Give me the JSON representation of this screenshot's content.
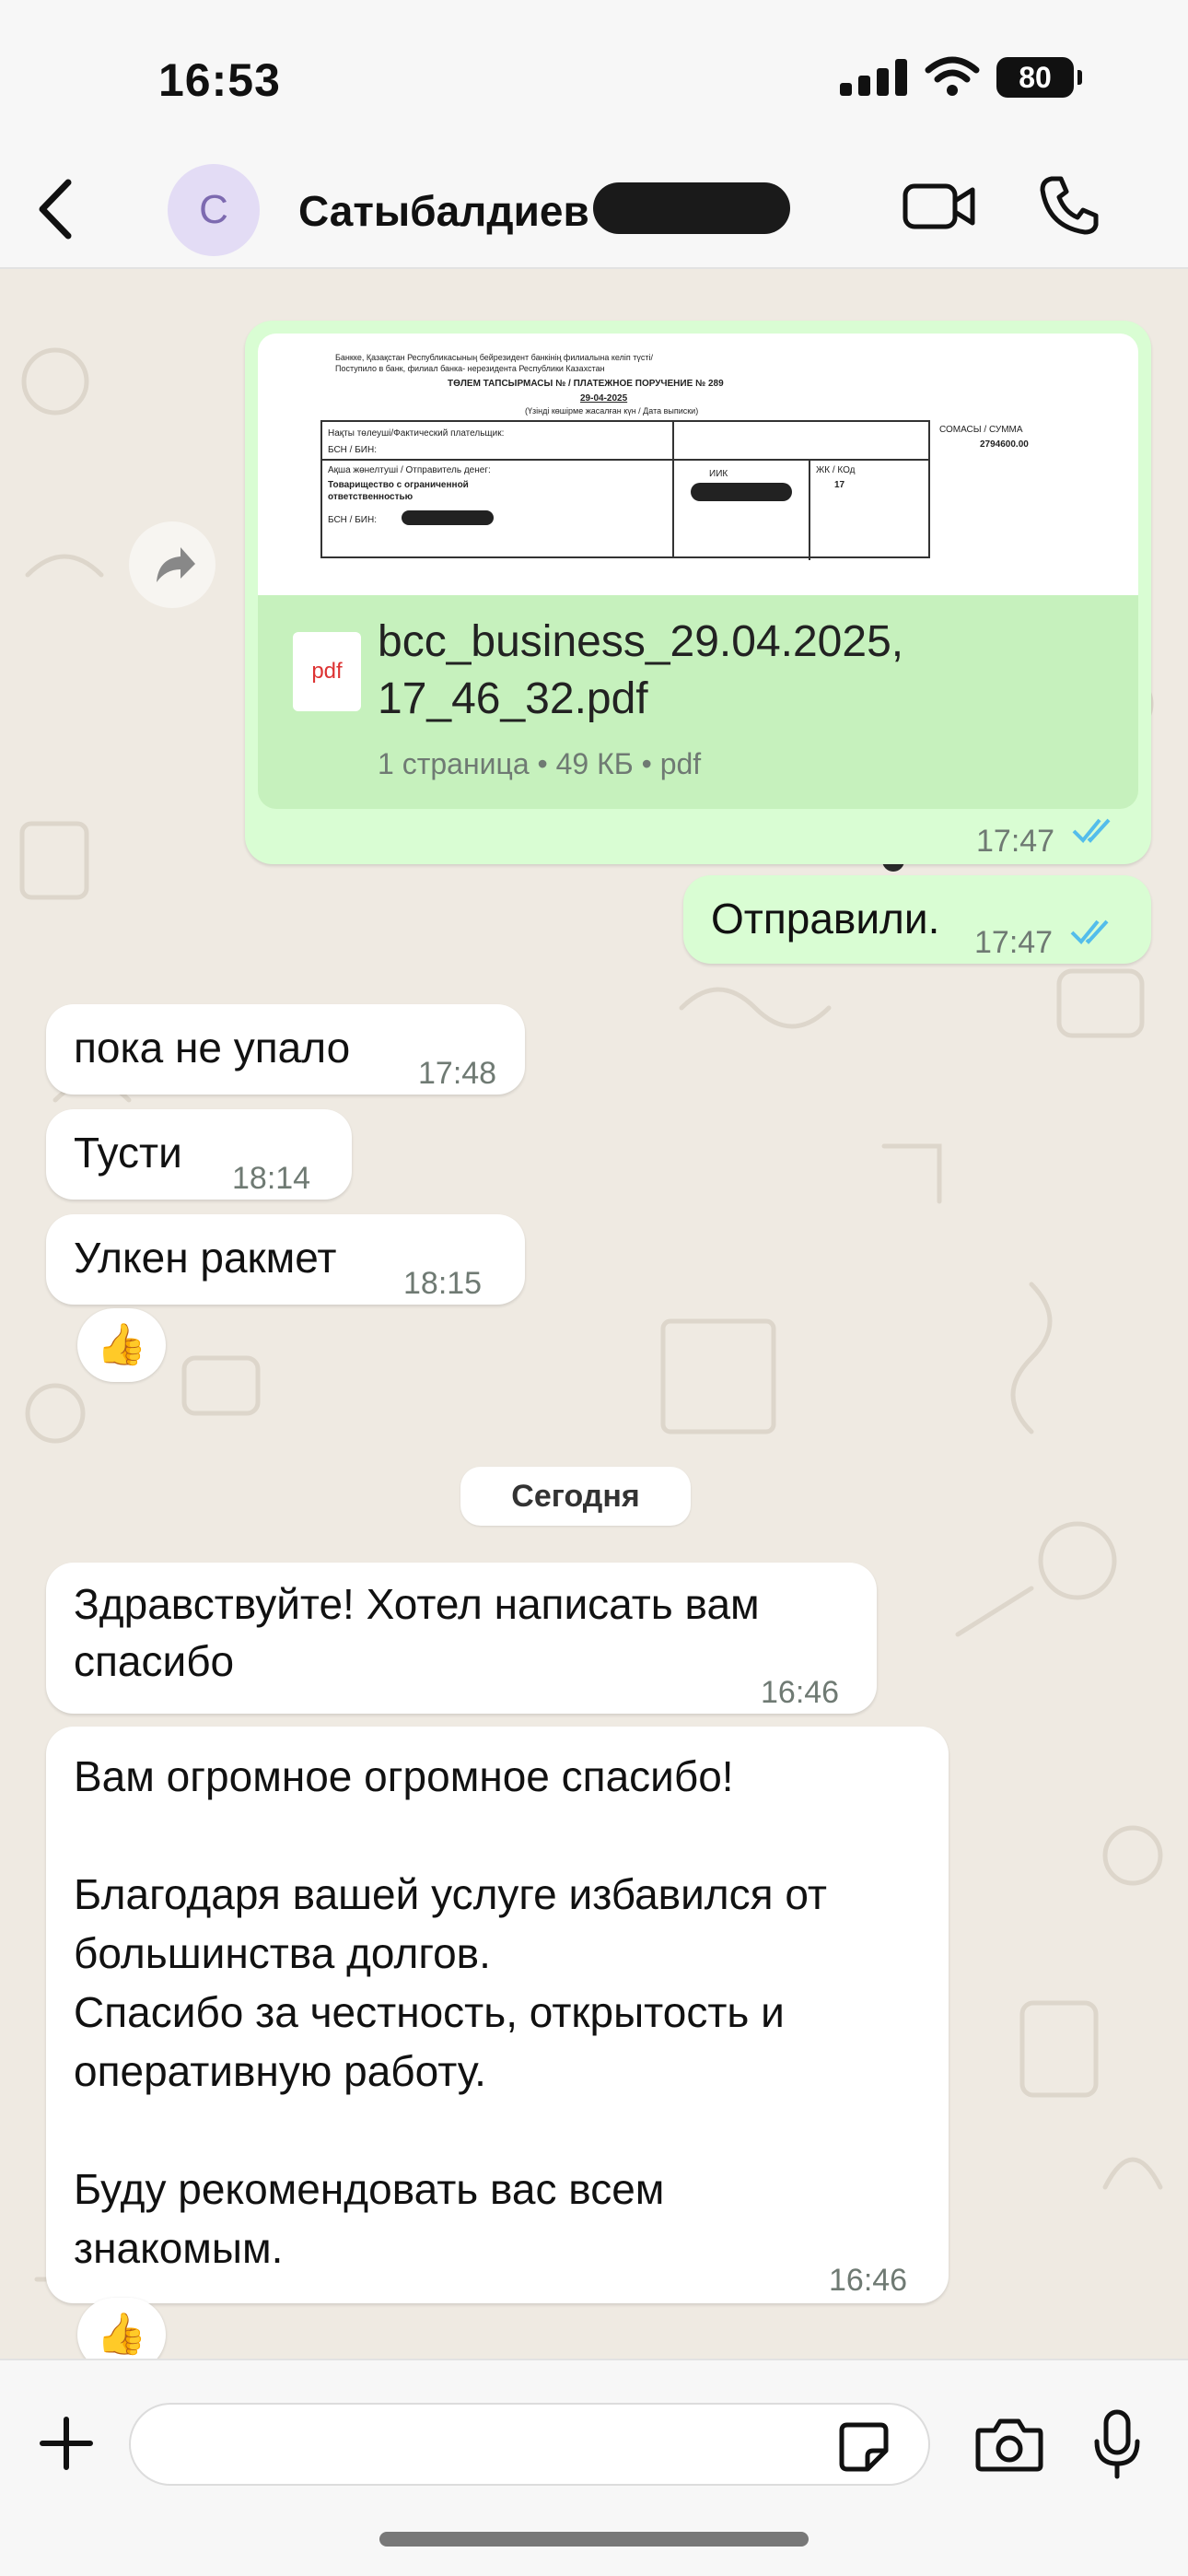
{
  "status_bar": {
    "time": "16:53",
    "battery": "80"
  },
  "header": {
    "avatar_letter": "С",
    "contact_name": "Сатыбалдиев"
  },
  "pdf_message": {
    "preview_lines": [
      "Банкке, Қазақстан Республикасының бейрезидент банкінің филиалына келіп түсті/",
      "Поступило в банк, филиал банка- нерезидента Республики Казахстан",
      "ТӨЛЕМ ТАПСЫРМАСЫ № / ПЛАТЕЖНОЕ ПОРУЧЕНИЕ № 289",
      "29-04-2025",
      "(Үзінді көшірме жасалған күн / Дата выписки)"
    ],
    "table": {
      "payer_label": "Нақты төлеуші/Фактический плательщик:",
      "bin_label_1": "БСН / БИН:",
      "sender_label": "Ақша жөнелтуші / Отправитель денег:",
      "sender_value": "Товарищество с ограниченной ответственностью",
      "bin_label_2": "БСН / БИН:",
      "iik_label": "ИИК",
      "kbe_label": "ЖК / КОд",
      "kbe_value": "17",
      "sum_label": "СОМАСЫ / СУММА",
      "sum_value": "2794600.00"
    },
    "file_icon_label": "pdf",
    "file_name": "bcc_business_29.04.2025,\n17_46_32.pdf",
    "file_meta": "1 страница • 49 КБ • pdf",
    "time": "17:47"
  },
  "messages": [
    {
      "text": "Отправили.",
      "time": "17:47",
      "direction": "out"
    },
    {
      "text": "пока не упало",
      "time": "17:48",
      "direction": "in"
    },
    {
      "text": "Тусти",
      "time": "18:14",
      "direction": "in"
    },
    {
      "text": "Улкен ракмет",
      "time": "18:15",
      "direction": "in"
    },
    {
      "text": "Здравствуйте! Хотел написать вам\nспасибо",
      "time": "16:46",
      "direction": "in"
    },
    {
      "text": "Вам огромное огромное спасибо!\n\nБлагодаря вашей услуге избавился от\nбольшинства долгов.\nСпасибо за честность, открытость и\nоперативную работу.\n\nБуду рекомендовать вас всем\nзнакомым.",
      "time": "16:46",
      "direction": "in"
    }
  ],
  "reactions": {
    "first": "👍",
    "second": "👍"
  },
  "date_divider": "Сегодня",
  "composer": {
    "placeholder": ""
  },
  "colors": {
    "outgoing_bubble": "#d9fdd3",
    "incoming_bubble": "#ffffff",
    "read_ticks": "#53bdeb",
    "chat_background": "#efeae2"
  }
}
